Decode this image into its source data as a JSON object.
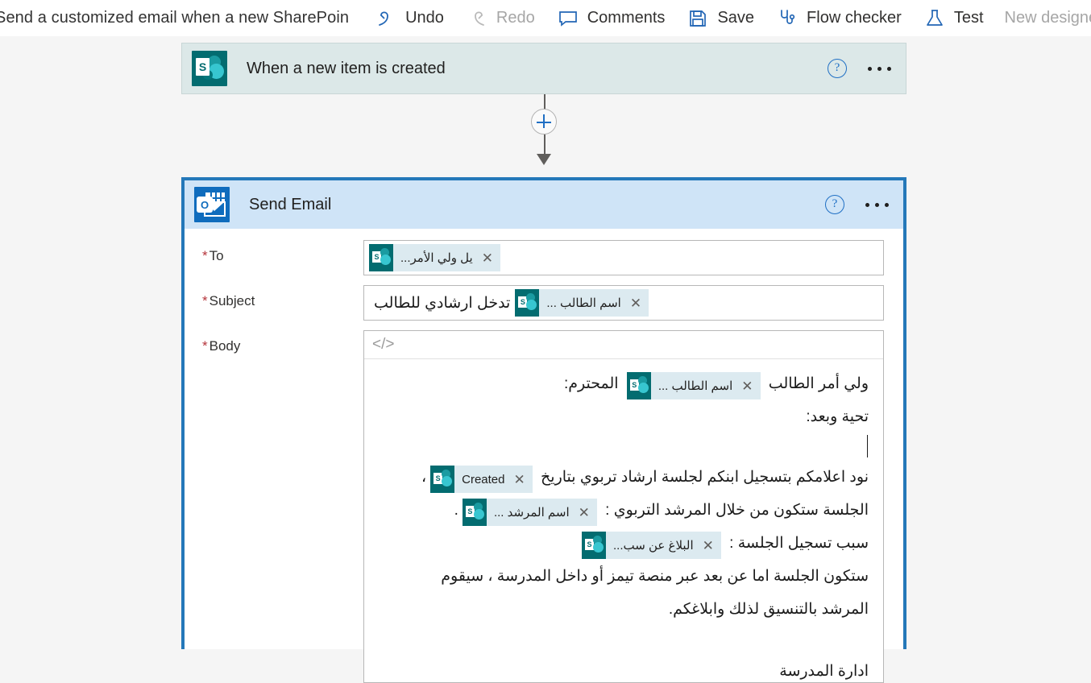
{
  "commandbar": {
    "flow_title": "Send a customized email when a new SharePoin",
    "items": [
      {
        "label": "Undo",
        "icon": "undo-icon",
        "disabled": false
      },
      {
        "label": "Redo",
        "icon": "redo-icon",
        "disabled": true
      },
      {
        "label": "Comments",
        "icon": "comment-icon",
        "disabled": false
      },
      {
        "label": "Save",
        "icon": "save-icon",
        "disabled": false
      },
      {
        "label": "Flow checker",
        "icon": "flow-checker-icon",
        "disabled": false
      },
      {
        "label": "Test",
        "icon": "test-flask-icon",
        "disabled": false
      },
      {
        "label": "New designer",
        "icon": "none",
        "disabled": true
      }
    ]
  },
  "trigger_card": {
    "title": "When a new item is created",
    "icon": "sharepoint-icon",
    "help_label": "?",
    "more_label": "•••"
  },
  "connector": {
    "add_label": "+"
  },
  "action_card": {
    "title": "Send Email",
    "icon": "outlook-icon",
    "help_label": "?",
    "more_label": "•••",
    "fields": {
      "to": {
        "label": "To",
        "required_marker": "*",
        "tokens": [
          {
            "label": "يل ولي الأمر...",
            "remove_label": "✕",
            "icon": "sharepoint-token-icon"
          }
        ]
      },
      "subject": {
        "label": "Subject",
        "required_marker": "*",
        "text": "تدخل ارشادي للطالب",
        "tokens": [
          {
            "label": "اسم الطالب ...",
            "remove_label": "✕",
            "icon": "sharepoint-token-icon"
          }
        ]
      },
      "body": {
        "label": "Body",
        "required_marker": "*",
        "toolbar": {
          "code_view_label": "</>",
          "code_view_icon": "code-view-icon"
        },
        "lines": [
          {
            "type": "mixed",
            "parts": [
              {
                "kind": "text",
                "value": "ولي أمر الطالب "
              },
              {
                "kind": "token",
                "value": "اسم الطالب ...",
                "remove_label": "✕"
              },
              {
                "kind": "text",
                "value": " المحترم:"
              }
            ]
          },
          {
            "type": "text",
            "value": "تحية وبعد:"
          },
          {
            "type": "caret"
          },
          {
            "type": "mixed",
            "parts": [
              {
                "kind": "text",
                "value": "نود اعلامكم بتسجيل ابنكم لجلسة ارشاد تربوي بتاريخ "
              },
              {
                "kind": "token-ltr",
                "value": "Created",
                "remove_label": "✕"
              },
              {
                "kind": "text",
                "value": "،"
              }
            ]
          },
          {
            "type": "mixed",
            "parts": [
              {
                "kind": "text",
                "value": "الجلسة ستكون من خلال المرشد التربوي : "
              },
              {
                "kind": "token",
                "value": "اسم المرشد ...",
                "remove_label": "✕"
              },
              {
                "kind": "text",
                "value": "."
              }
            ]
          },
          {
            "type": "mixed",
            "parts": [
              {
                "kind": "text",
                "value": "سبب تسجيل الجلسة : "
              },
              {
                "kind": "token",
                "value": "البلاغ عن سب...",
                "remove_label": "✕"
              }
            ]
          },
          {
            "type": "text",
            "value": "ستكون الجلسة اما عن بعد عبر منصة تيمز أو داخل المدرسة ، سيقوم"
          },
          {
            "type": "text",
            "value": "المرشد بالتنسيق لذلك وابلاغكم."
          },
          {
            "type": "spacer"
          },
          {
            "type": "text",
            "value": "ادارة المدرسة"
          }
        ]
      }
    }
  },
  "colors": {
    "page_bg": "#f5f5f5",
    "trigger_header": "#dce8e8",
    "action_header": "#cfe4f7",
    "selection_border": "#2478b9",
    "sharepoint_teal": "#036c70",
    "outlook_blue": "#0f6cbd",
    "required_red": "#b5343b",
    "accent_blue": "#1f6fc4"
  }
}
